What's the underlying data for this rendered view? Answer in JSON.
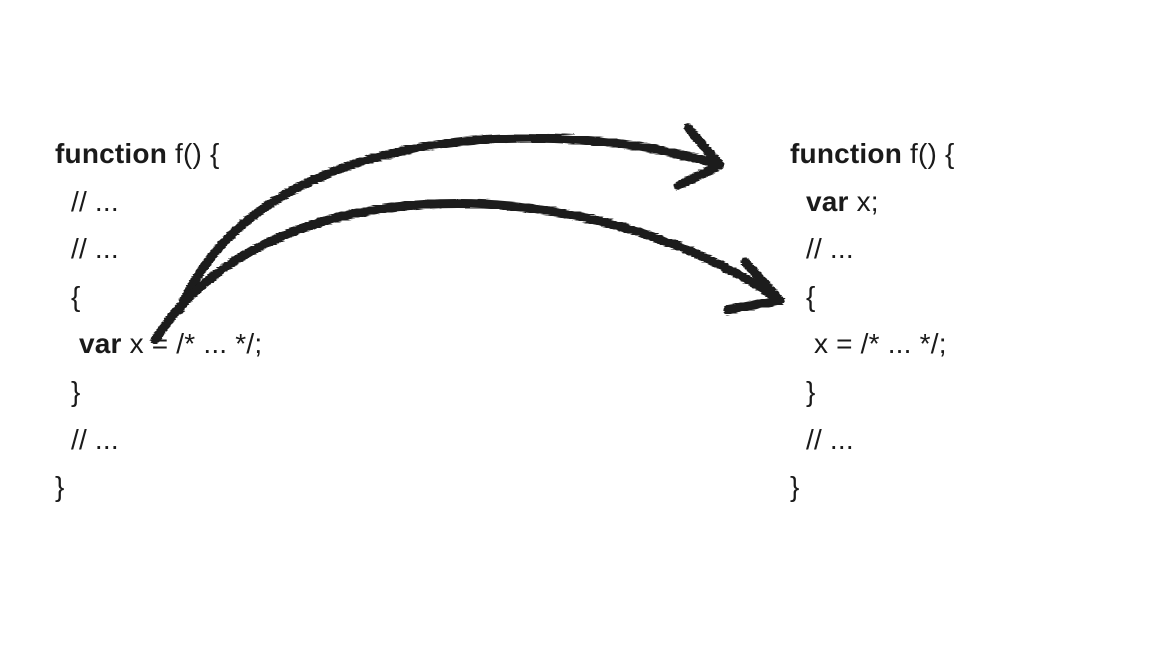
{
  "left_code": {
    "l1_kw": "function",
    "l1_rest": " f() {",
    "l2": "  // ...",
    "l3": "  // ...",
    "l4": "  {",
    "l5_indent": "   ",
    "l5_kw": "var",
    "l5_rest": " x = /* ... */;",
    "l6": "  }",
    "l7": "  // ...",
    "l8": "}"
  },
  "right_code": {
    "l1_kw": "function",
    "l1_rest": " f() {",
    "l2_indent": "  ",
    "l2_kw": "var",
    "l2_rest": " x;",
    "l3": "  // ...",
    "l4": "  {",
    "l5": "   x = /* ... */;",
    "l6": "  }",
    "l7": "  // ...",
    "l8": "}"
  }
}
